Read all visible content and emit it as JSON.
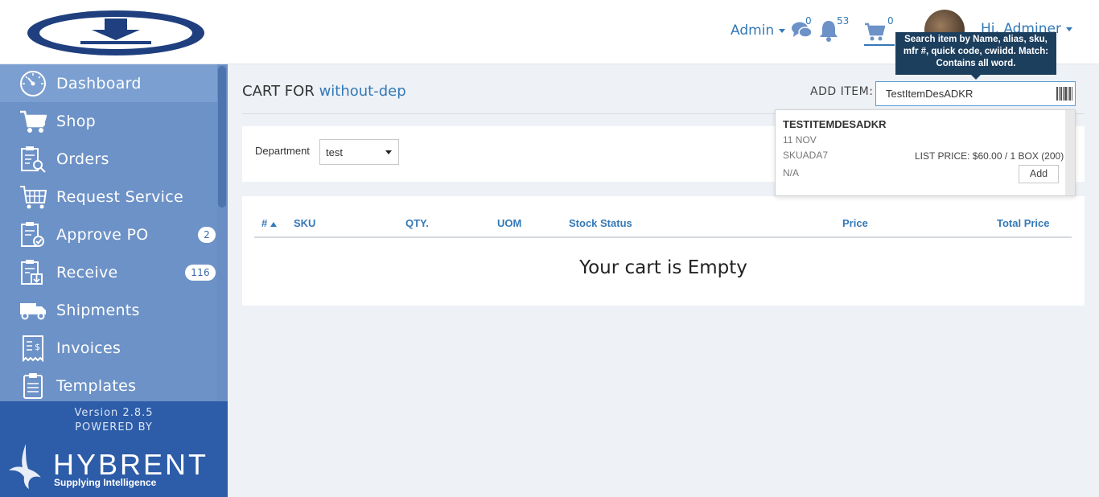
{
  "header": {
    "admin_label": "Admin",
    "messages_count": "0",
    "notifications_count": "53",
    "cart_count": "0",
    "user_label": "Hi, Adminer",
    "search_tooltip": "Search item by Name, alias, sku, mfr #, quick code, cwiidd. Match: Contains all word."
  },
  "sidebar": {
    "items": [
      {
        "label": "Dashboard",
        "icon": "dashboard-icon"
      },
      {
        "label": "Shop",
        "icon": "cart-icon"
      },
      {
        "label": "Orders",
        "icon": "orders-icon"
      },
      {
        "label": "Request Service",
        "icon": "request-service-icon"
      },
      {
        "label": "Approve PO",
        "icon": "approve-po-icon",
        "badge": "2"
      },
      {
        "label": "Receive",
        "icon": "receive-icon",
        "badge": "116"
      },
      {
        "label": "Shipments",
        "icon": "truck-icon"
      },
      {
        "label": "Invoices",
        "icon": "invoice-icon"
      },
      {
        "label": "Templates",
        "icon": "templates-icon"
      }
    ],
    "version": "Version 2.8.5",
    "powered_by": "POWERED BY",
    "brand": "HYBRENT",
    "tagline": "Supplying Intelligence"
  },
  "main": {
    "title_prefix": "CART FOR",
    "department_name": "without-dep",
    "add_item_label": "ADD ITEM:",
    "add_item_value": "TestItemDesADKR",
    "department_label": "Department",
    "department_value": "test",
    "table_headers": [
      "#",
      "SKU",
      "QTY.",
      "UOM",
      "Stock Status",
      "Price",
      "Total Price"
    ],
    "empty_message": "Your cart is Empty"
  },
  "dropdown": {
    "item_name": "TESTITEMDESADKR",
    "date": "11 NOV",
    "sku": "SKUADA7",
    "vendor": "N/A",
    "list_price": "LIST PRICE:  $60.00 / 1 BOX (200)",
    "add_label": "Add"
  },
  "colors": {
    "accent": "#3479b7",
    "sidebar": "#6d92c7",
    "sidebar_footer": "#2d5ca8",
    "tooltip": "#1d3f5e"
  }
}
